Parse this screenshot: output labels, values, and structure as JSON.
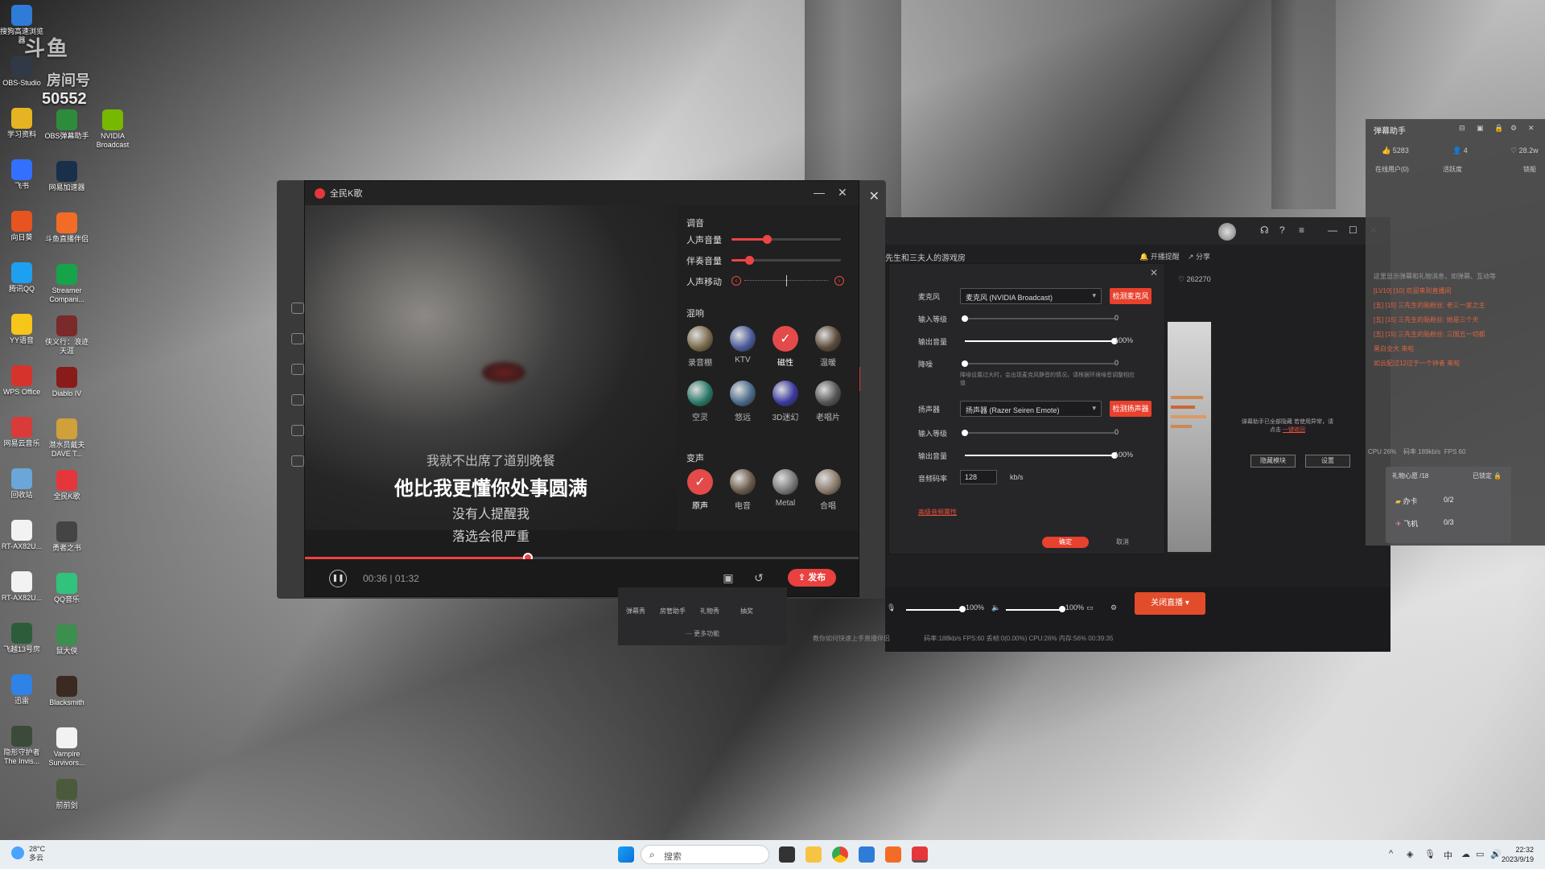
{
  "desktop": {
    "icons": [
      {
        "label": "搜狗高速浏览器",
        "color": "#2f7bd8"
      },
      {
        "label": "OBS-Studio",
        "color": "#303a46"
      },
      {
        "label": "学习资料",
        "color": "#e6b422"
      },
      {
        "label": "飞书",
        "color": "#3370ff"
      },
      {
        "label": "向日葵",
        "color": "#e8541f"
      },
      {
        "label": "腾讯QQ",
        "color": "#1ea0f0"
      },
      {
        "label": "YY语音",
        "color": "#f6c61a"
      },
      {
        "label": "WPS Office",
        "color": "#d6332a"
      },
      {
        "label": "网易云音乐",
        "color": "#d93a3a"
      },
      {
        "label": "回收站",
        "color": "#6aa7d8"
      },
      {
        "label": "RT-AX82U...",
        "color": "#f2f2f2"
      },
      {
        "label": "RT-AX82U...",
        "color": "#f2f2f2"
      },
      {
        "label": "飞越13号房",
        "color": "#2b5d3a"
      },
      {
        "label": "迅雷",
        "color": "#2f82e6"
      },
      {
        "label": "隐形守护者 The Invis...",
        "color": "#3b4a3a"
      }
    ],
    "icons_col2": [
      {
        "label": "OBS弹幕助手",
        "color": "#2d8c3c"
      },
      {
        "label": "网易加速器",
        "color": "#1a2f4a"
      },
      {
        "label": "斗鱼直播伴侣",
        "color": "#f26c28"
      },
      {
        "label": "Streamer Compani...",
        "color": "#16a34a"
      },
      {
        "label": "侠义行：浪迹天涯",
        "color": "#7a2a2a"
      },
      {
        "label": "Diablo IV",
        "color": "#8a1b1b"
      },
      {
        "label": "潜水员戴夫 DAVE T...",
        "color": "#d0a03a"
      },
      {
        "label": "全民K歌",
        "color": "#e5373b"
      },
      {
        "label": "勇者之书",
        "color": "#444"
      },
      {
        "label": "QQ音乐",
        "color": "#31c27c"
      },
      {
        "label": "鼠大侠",
        "color": "#3d8f4d"
      },
      {
        "label": "Blacksmith",
        "color": "#3a2a22"
      },
      {
        "label": "Vampire Survivors...",
        "color": "#f2f2f2"
      },
      {
        "label": "前前剑",
        "color": "#4a5a3a"
      }
    ],
    "icons_col3": [
      {
        "label": "NVIDIA Broadcast",
        "color": "#76b900"
      }
    ],
    "streamer_overlay": {
      "text": "房间号",
      "number": "50552"
    }
  },
  "karaoke": {
    "title": "全民K歌",
    "lyrics": {
      "prev": "我就不出席了道别晚餐",
      "current": "他比我更懂你处事圆满",
      "next1": "没有人提醒我",
      "next2": "落选会很严重"
    },
    "tuning_title": "调音",
    "sliders": [
      {
        "label": "人声音量",
        "value": 0.32
      },
      {
        "label": "伴奏音量",
        "value": 0.16
      }
    ],
    "pitch_label": "人声移动",
    "reverb_title": "混响",
    "reverbs": [
      {
        "label": "录音棚",
        "color": "#7a6a4a",
        "selected": false
      },
      {
        "label": "KTV",
        "color": "#4a5a9a",
        "selected": false
      },
      {
        "label": "磁性",
        "color": "#e34a4a",
        "selected": true
      },
      {
        "label": "温暖",
        "color": "#5a4a3a",
        "selected": false
      },
      {
        "label": "空灵",
        "color": "#2a7a6a",
        "selected": false
      },
      {
        "label": "悠远",
        "color": "#4a6a8a",
        "selected": false
      },
      {
        "label": "3D迷幻",
        "color": "#3a3aa0",
        "selected": false
      },
      {
        "label": "老唱片",
        "color": "#555",
        "selected": false
      }
    ],
    "voice_title": "变声",
    "voices": [
      {
        "label": "原声",
        "color": "#e34a4a",
        "selected": true
      },
      {
        "label": "电音",
        "color": "#6a5a4a",
        "selected": false
      },
      {
        "label": "Metal",
        "color": "#777",
        "selected": false
      },
      {
        "label": "合唱",
        "color": "#8a7a6a",
        "selected": false
      }
    ],
    "progress": 0.402,
    "time": "00:36 | 01:32",
    "publish_label": "发布"
  },
  "live": {
    "room_title": "先生和三夫人的游戏房",
    "reminder": "开播提醒",
    "share": "分享",
    "hot": "262270",
    "left_dock": [
      {
        "label": "弹幕秀"
      },
      {
        "label": "房管助手"
      },
      {
        "label": "礼物秀"
      },
      {
        "label": "抽奖"
      }
    ],
    "more": "更多功能",
    "mic_volume": "100%",
    "speaker_volume": "100%",
    "stop_label": "关闭直播",
    "status": "教你如何快速上手直播伴侣",
    "stats": "码率:188kb/s   FPS:60   丢帧:0(0.00%)   CPU:26%   内存:56%   00:39:35"
  },
  "audio_dialog": {
    "mic_label": "麦克风",
    "mic_device": "麦克风 (NVIDIA Broadcast)",
    "mic_test": "检测麦克风",
    "input_level": "输入等级",
    "input_level_value": "0",
    "output_volume": "输出音量",
    "output_volume_value": "100%",
    "noise": "降噪",
    "noise_value": "0",
    "noise_note": "降噪设置过大时，会出现麦克风静音的情况，请根据环境噪音调整相应值",
    "speaker_label": "扬声器",
    "speaker_device": "扬声器 (Razer Seiren Emote)",
    "speaker_test": "检测扬声器",
    "speaker_input_level_value": "0",
    "speaker_output_value": "100%",
    "bitrate_label": "音频码率",
    "bitrate": "128",
    "bitrate_unit": "kb/s",
    "advanced": "高级音频属性",
    "ok": "确定",
    "cancel": "取消"
  },
  "danmaku": {
    "title": "弹幕助手",
    "likes": "5283",
    "users": "4",
    "hearts": "28.2w",
    "online": "在线用户(0)",
    "activity": "活跃度",
    "lock": "锁船",
    "notice": "弹幕助手已全部隐藏 若使用异常，请点击",
    "notice_link": "一键收回",
    "hide_btn": "隐藏模块",
    "settings_btn": "设置",
    "cpu": "CPU 26%",
    "bitrate": "码率 189kb/s",
    "fps": "FPS 60",
    "gift_title": "礼物心愿",
    "gift_count": "/18",
    "gift_locked": "已锁定",
    "gift_rows": [
      {
        "name": "办卡",
        "count": "0/2"
      },
      {
        "name": "飞机",
        "count": "0/3"
      }
    ],
    "messages": [
      "这里显示弹幕和礼物消息，如弹幕、互动等",
      "[LV10] [10] 欢迎来到直播间",
      "[五] [15] 三先生的贴粉丝: 老三一家之主",
      "[五] [15] 三先生的贴粉丝: 她是三个天",
      "[五] [15] 三先生的贴粉丝: 三国五一切都",
      "黑白全大 来啦",
      "如云配过12过于一个钟者 来啦"
    ]
  },
  "taskbar": {
    "weather_temp": "28°C",
    "weather_desc": "多云",
    "search": "搜索",
    "ime": "中",
    "time": "22:32",
    "date": "2023/9/19"
  }
}
